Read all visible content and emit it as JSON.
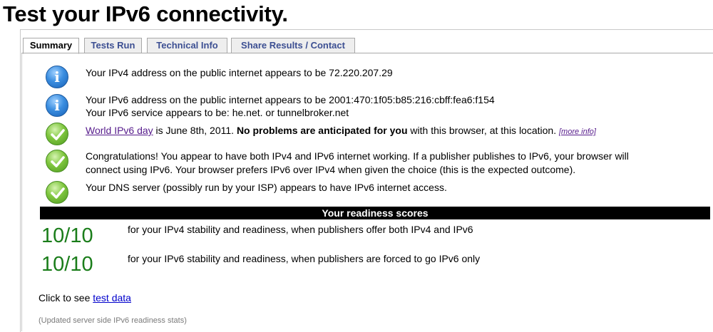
{
  "page": {
    "title": "Test your IPv6 connectivity."
  },
  "tabs": [
    {
      "label": "Summary",
      "active": true
    },
    {
      "label": "Tests Run",
      "active": false
    },
    {
      "label": "Technical Info",
      "active": false
    },
    {
      "label": "Share Results / Contact",
      "active": false
    }
  ],
  "messages": {
    "ipv4": {
      "icon": "info-icon",
      "text": "Your IPv4 address on the public internet appears to be 72.220.207.29"
    },
    "ipv6": {
      "icon": "info-icon",
      "line1": "Your IPv6 address on the public internet appears to be 2001:470:1f05:b85:216:cbff:fea6:f154",
      "line2": "Your IPv6 service appears to be: he.net. or tunnelbroker.net"
    },
    "worldday": {
      "icon": "checkmark-icon",
      "link": "World IPv6 day",
      "text_mid": " is June 8th, 2011. ",
      "bold": "No problems are anticipated for you",
      "text_end": " with this browser, at this location. ",
      "more": "[more info]"
    },
    "congrats": {
      "icon": "checkmark-icon",
      "line1": "Congratulations! You appear to have both IPv4 and IPv6 internet working. If a publisher publishes to IPv6, your browser will",
      "line2": "connect using IPv6. Your browser prefers IPv6 over IPv4 when given the choice (this is the expected outcome)."
    },
    "dns": {
      "icon": "checkmark-icon",
      "text": "Your DNS server (possibly run by your ISP) appears to have IPv6 internet access."
    }
  },
  "readiness": {
    "title": "Your readiness scores",
    "scores": [
      {
        "score": "10/10",
        "desc": "for your IPv4 stability and readiness, when publishers offer both IPv4 and IPv6"
      },
      {
        "score": "10/10",
        "desc": "for your IPv6 stability and readiness, when publishers are forced to go IPv6 only"
      }
    ]
  },
  "footer": {
    "click_text": "Click to see ",
    "test_data_link": "test data",
    "updated": "(Updated server side IPv6 readiness stats)"
  },
  "colors": {
    "score_green": "#1a7d1a",
    "tab_text": "#3c4f92",
    "link": "#0000cc",
    "visited_link": "#551a8b"
  }
}
